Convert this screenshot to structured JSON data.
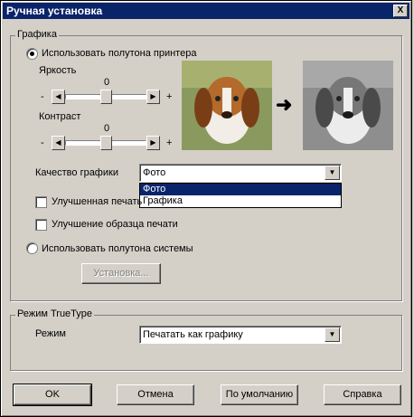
{
  "window": {
    "title": "Ручная установка",
    "close_label": "X"
  },
  "graphics": {
    "group_label": "Графика",
    "radio_printer": "Использовать полутона принтера",
    "brightness": {
      "label": "Яркость",
      "value": "0",
      "minus": "-",
      "plus": "+",
      "level_fraction": 0.5
    },
    "contrast": {
      "label": "Контраст",
      "value": "0",
      "minus": "-",
      "plus": "+",
      "level_fraction": 0.5
    },
    "quality": {
      "label": "Качество графики",
      "value": "Фото",
      "options": [
        "Фото",
        "Графика"
      ]
    },
    "improved_print": "Улучшенная печать",
    "improved_sample": "Улучшение образца печати",
    "radio_system": "Использовать полутона системы",
    "setup_button": "Установка...",
    "arrow": "➜"
  },
  "truetype": {
    "group_label": "Режим TrueType",
    "mode_label": "Режим",
    "mode_value": "Печатать как графику"
  },
  "buttons": {
    "ok": "OK",
    "cancel": "Отмена",
    "default": "По умолчанию",
    "help": "Справка"
  },
  "colors": {
    "titlebar": "#0a246a",
    "face": "#d4d0c8"
  }
}
